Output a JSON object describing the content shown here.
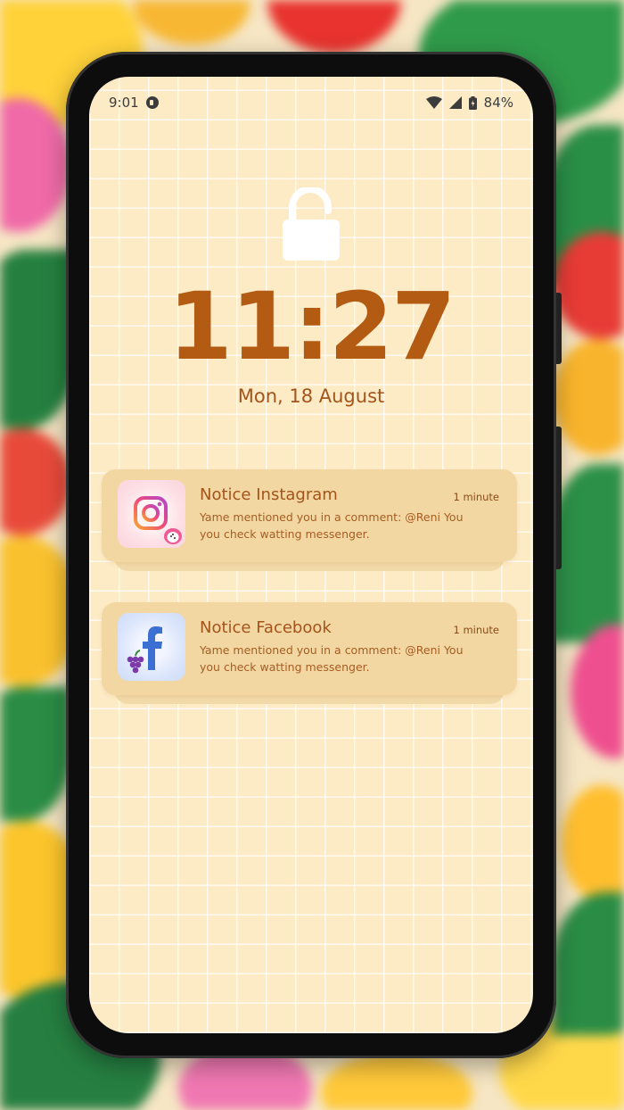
{
  "status_bar": {
    "time": "9:01",
    "battery": "84%",
    "icons": [
      "app-icon",
      "wifi-icon",
      "signal-icon",
      "battery-icon"
    ]
  },
  "lock_screen": {
    "lock_icon": "unlocked-padlock-icon",
    "clock": "11:27",
    "date": "Mon, 18 August"
  },
  "notifications": [
    {
      "app_icon": "instagram-icon",
      "title": "Notice Instagram",
      "time": "1 minute",
      "body": "Yame mentioned you in a comment: @Reni You you check watting messenger."
    },
    {
      "app_icon": "facebook-icon",
      "title": "Notice Facebook",
      "time": "1 minute",
      "body": "Yame mentioned you in a comment: @Reni You you check watting messenger."
    }
  ],
  "colors": {
    "screen_bg": "#fdebc6",
    "clock_text": "#b35a13",
    "notification_bg": "#f3d7a3",
    "notification_text": "#a3541b"
  }
}
